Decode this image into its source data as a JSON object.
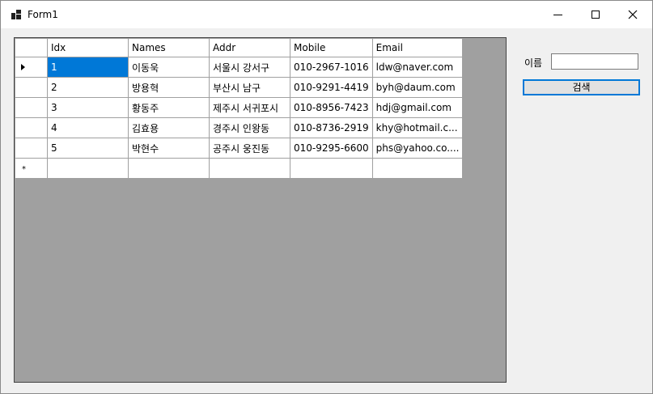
{
  "window": {
    "title": "Form1"
  },
  "grid": {
    "columns": [
      "Idx",
      "Names",
      "Addr",
      "Mobile",
      "Email"
    ],
    "rows": [
      [
        "1",
        "이동욱",
        "서울시 강서구",
        "010-2967-1016",
        "ldw@naver.com"
      ],
      [
        "2",
        "방용혁",
        "부산시 남구",
        "010-9291-4419",
        "byh@daum.com"
      ],
      [
        "3",
        "황동주",
        "제주시 서귀포시",
        "010-8956-7423",
        "hdj@gmail.com"
      ],
      [
        "4",
        "김효용",
        "경주시 인왕동",
        "010-8736-2919",
        "khy@hotmail.c..."
      ],
      [
        "5",
        "박현수",
        "공주시 웅진동",
        "010-9295-6600",
        "phs@yahoo.co...."
      ]
    ],
    "new_row_marker": "*"
  },
  "search": {
    "label": "이름",
    "value": "",
    "button_label": "검색"
  },
  "colors": {
    "selection": "#0078d7",
    "grid_background": "#a0a0a0"
  }
}
